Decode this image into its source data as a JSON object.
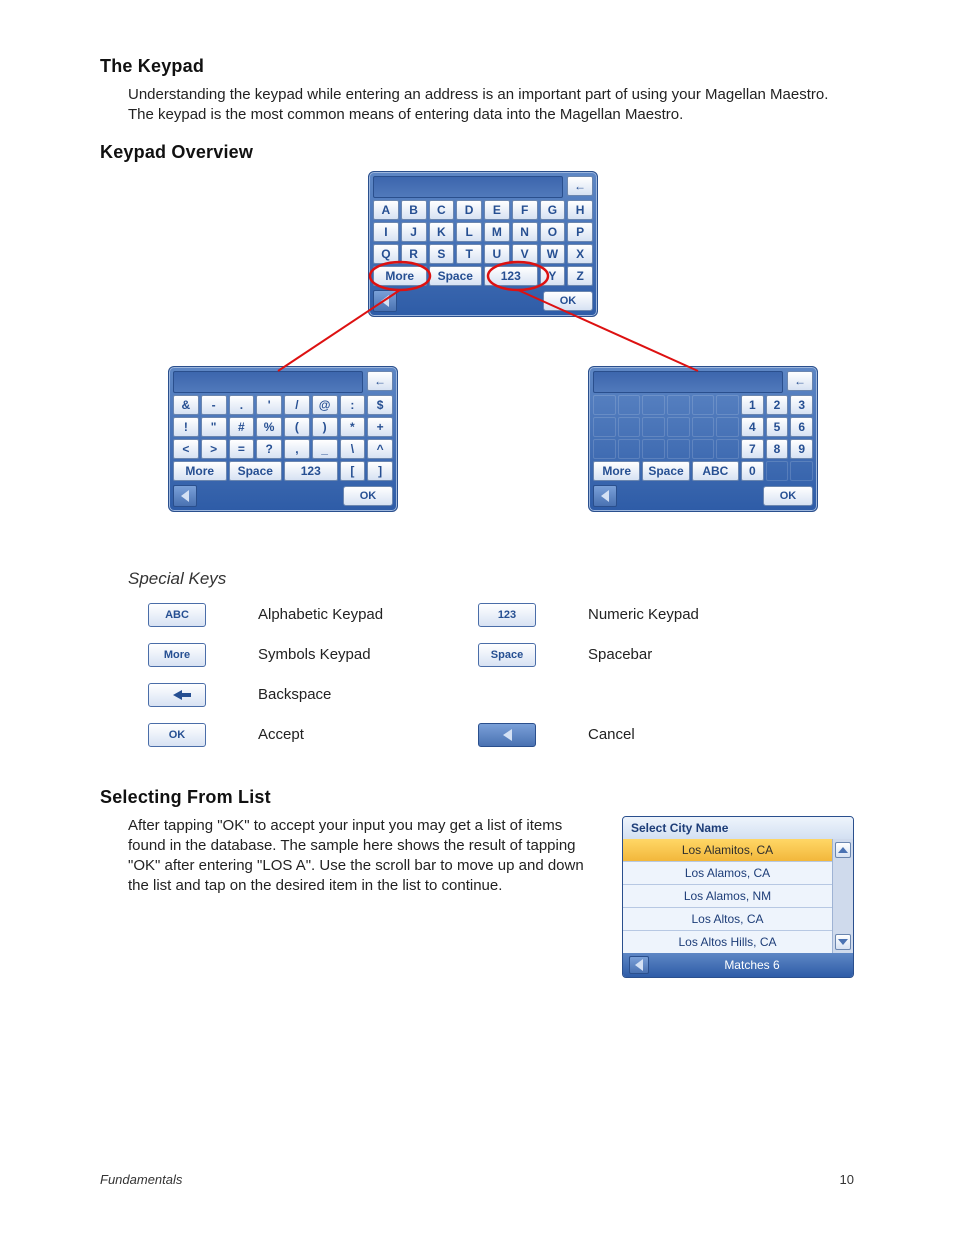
{
  "sections": {
    "keypad_title": "The Keypad",
    "keypad_body": "Understanding the keypad while entering an address is an important part of using your Magellan Maestro.  The keypad is the most common means of entering data into the Magellan Maestro.",
    "overview_title": "Keypad Overview",
    "specials_title": "Special Keys",
    "select_title": "Selecting From List",
    "select_body": "After tapping \"OK\" to accept your input you may get a list of items found in the database.  The sample here shows the result of tapping \"OK\" after entering \"LOS A\".  Use the scroll bar to move up and down the list and tap on the desired item in the list to continue."
  },
  "keypad_alpha": {
    "rows": [
      [
        "A",
        "B",
        "C",
        "D",
        "E",
        "F",
        "G",
        "H"
      ],
      [
        "I",
        "J",
        "K",
        "L",
        "M",
        "N",
        "O",
        "P"
      ],
      [
        "Q",
        "R",
        "S",
        "T",
        "U",
        "V",
        "W",
        "X"
      ]
    ],
    "more": "More",
    "space": "Space",
    "num": "123",
    "y": "Y",
    "z": "Z",
    "ok": "OK"
  },
  "keypad_sym": {
    "rows": [
      [
        "&",
        "-",
        ".",
        "'",
        "/",
        "@",
        ":",
        "$"
      ],
      [
        "!",
        "\"",
        "#",
        "%",
        "(",
        ")",
        "*",
        "+"
      ],
      [
        "<",
        ">",
        "=",
        "?",
        ",",
        "_",
        "\\",
        "^"
      ]
    ],
    "more": "More",
    "space": "Space",
    "num": "123",
    "lb": "[",
    "rb": "]",
    "ok": "OK"
  },
  "keypad_num": {
    "rows": [
      [
        "",
        "",
        "",
        "",
        "",
        "",
        "1",
        "2",
        "3"
      ],
      [
        "",
        "",
        "",
        "",
        "",
        "",
        "4",
        "5",
        "6"
      ],
      [
        "",
        "",
        "",
        "",
        "",
        "",
        "7",
        "8",
        "9"
      ]
    ],
    "more": "More",
    "space": "Space",
    "abc": "ABC",
    "zero": "0",
    "ok": "OK"
  },
  "special_keys": {
    "abc": {
      "chip": "ABC",
      "desc": "Alphabetic Keypad"
    },
    "num": {
      "chip": "123",
      "desc": "Numeric Keypad"
    },
    "more": {
      "chip": "More",
      "desc": "Symbols Keypad"
    },
    "space": {
      "chip": "Space",
      "desc": "Spacebar"
    },
    "back": {
      "desc": "Backspace"
    },
    "ok": {
      "chip": "OK",
      "desc": "Accept"
    },
    "cancel": {
      "desc": "Cancel"
    }
  },
  "city_list": {
    "header": "Select City Name",
    "items": [
      "Los Alamitos, CA",
      "Los Alamos, CA",
      "Los Alamos, NM",
      "Los Altos, CA",
      "Los Altos Hills, CA"
    ],
    "matches": "Matches  6"
  },
  "footer": {
    "section": "Fundamentals",
    "page": "10"
  }
}
